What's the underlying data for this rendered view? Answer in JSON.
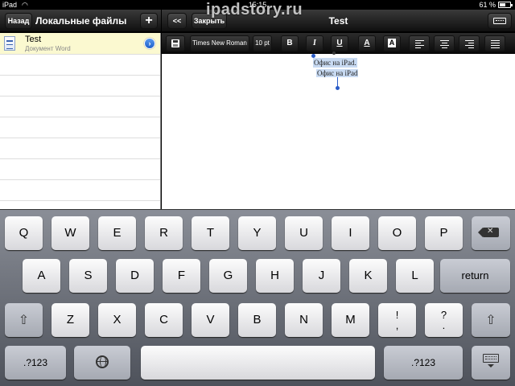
{
  "status_bar": {
    "carrier": "iPad",
    "time": "15:15",
    "battery_percent": "61 %",
    "battery_level": 0.61
  },
  "left_panel": {
    "back_label": "Назад",
    "title": "Локальные файлы",
    "add_label": "+",
    "files": [
      {
        "name": "Test",
        "type": "Документ Word"
      }
    ]
  },
  "document_panel": {
    "collapse_label": "<<",
    "close_label": "Закрыть",
    "title": "Test"
  },
  "toolbar": {
    "font_name": "Times New Roman",
    "font_size": "10 pt",
    "bold": "B",
    "italic": "I",
    "underline": "U",
    "font_color": "A",
    "highlight": "A"
  },
  "document": {
    "lines": [
      "Офис на iPad.",
      "Офис на iPad"
    ]
  },
  "keyboard": {
    "row1": [
      "Q",
      "W",
      "E",
      "R",
      "T",
      "Y",
      "U",
      "I",
      "O",
      "P"
    ],
    "row2": [
      "A",
      "S",
      "D",
      "F",
      "G",
      "H",
      "J",
      "K",
      "L"
    ],
    "row3": [
      "Z",
      "X",
      "C",
      "V",
      "B",
      "N",
      "M"
    ],
    "return_label": "return",
    "punct1": "!\n,",
    "punct2": "?\n.",
    "numbers_label": ".?123"
  },
  "watermark": "ipadstory.ru",
  "colors": {
    "selection": "#c8daf2",
    "selected_row": "#fbf9d0",
    "accent": "#2a5cc8"
  }
}
